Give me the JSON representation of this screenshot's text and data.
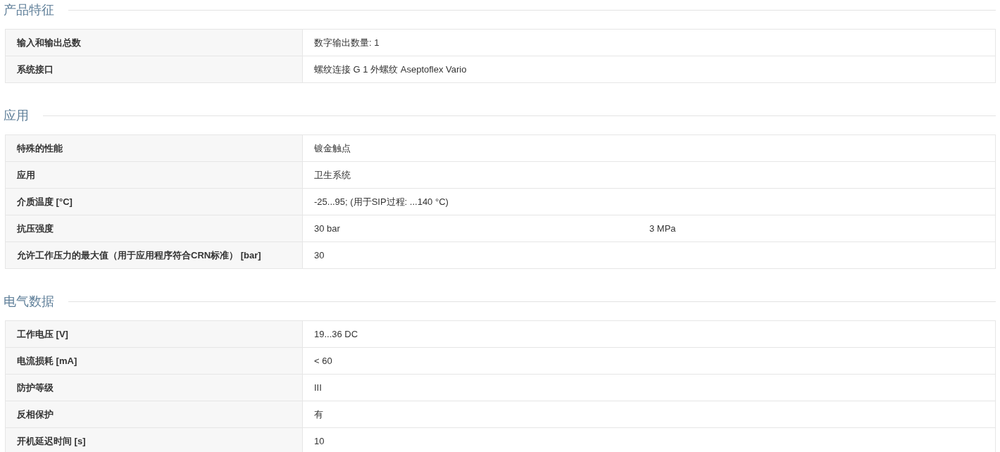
{
  "sections": [
    {
      "title": "产品特征",
      "rows": [
        {
          "label": "输入和输出总数",
          "values": [
            "数字输出数量: 1"
          ]
        },
        {
          "label": "系统接口",
          "values": [
            "螺纹连接 G 1 外螺纹 Aseptoflex Vario"
          ]
        }
      ]
    },
    {
      "title": "应用",
      "rows": [
        {
          "label": "特殊的性能",
          "values": [
            "镀金触点"
          ]
        },
        {
          "label": "应用",
          "values": [
            "卫生系统"
          ]
        },
        {
          "label": "介质温度 [°C]",
          "values": [
            "-25...95; (用于SIP过程: ...140 °C)"
          ]
        },
        {
          "label": "抗压强度",
          "values": [
            "30 bar",
            "3 MPa"
          ]
        },
        {
          "label": "允许工作压力的最大值（用于应用程序符合CRN标准） [bar]",
          "values": [
            "30"
          ]
        }
      ]
    },
    {
      "title": "电气数据",
      "rows": [
        {
          "label": "工作电压 [V]",
          "values": [
            "19...36 DC"
          ]
        },
        {
          "label": "电流损耗 [mA]",
          "values": [
            "< 60"
          ]
        },
        {
          "label": "防护等级",
          "values": [
            "III"
          ]
        },
        {
          "label": "反相保护",
          "values": [
            "有"
          ]
        },
        {
          "label": "开机延迟时间 [s]",
          "values": [
            "10"
          ]
        }
      ]
    }
  ]
}
